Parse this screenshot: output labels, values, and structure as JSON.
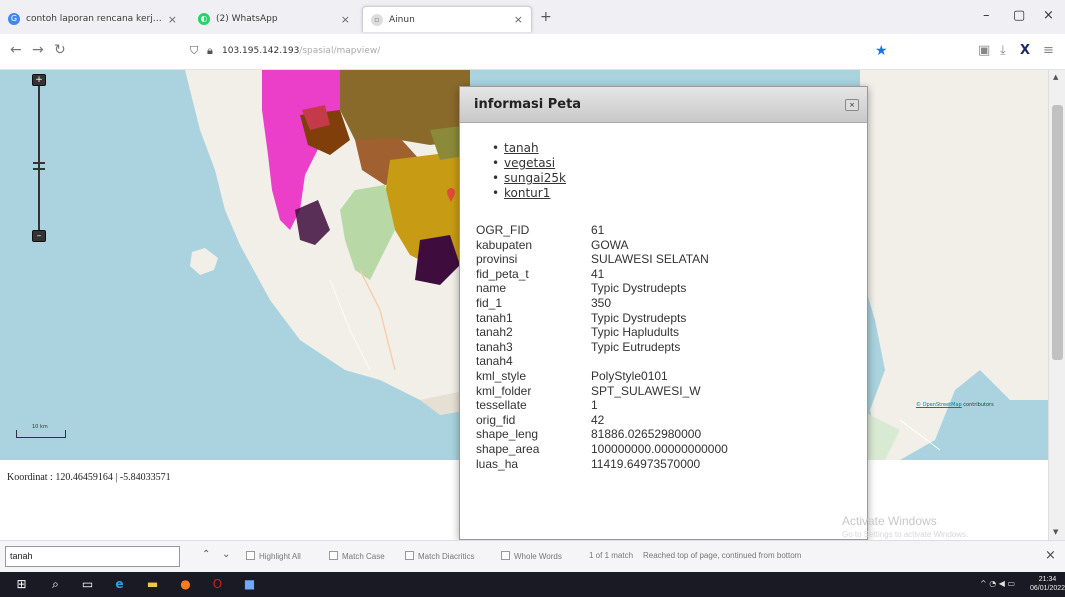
{
  "browser": {
    "tabs": [
      {
        "label": "contoh laporan rencana kerja - ",
        "icon": "google-icon",
        "active": false
      },
      {
        "label": "(2) WhatsApp",
        "icon": "whatsapp-icon",
        "active": false
      },
      {
        "label": "Ainun",
        "icon": "page-icon",
        "active": true
      }
    ],
    "new_tab": "+",
    "url_host": "103.195.142.193",
    "url_path": "/spasial/mapview/"
  },
  "map": {
    "scale_label": "10 km",
    "attribution_link": "© OpenStreetMap",
    "attribution_text": " contributors",
    "coordinates": "Koordinat : 120.46459164 | -5.84033571"
  },
  "popup": {
    "title": "informasi Peta",
    "close": "×",
    "layers": [
      "tanah",
      "vegetasi",
      "sungai25k",
      "kontur1"
    ],
    "attributes": [
      {
        "key": "OGR_FID",
        "value": "61"
      },
      {
        "key": "kabupaten",
        "value": "GOWA"
      },
      {
        "key": "provinsi",
        "value": "SULAWESI SELATAN"
      },
      {
        "key": "fid_peta_t",
        "value": "41"
      },
      {
        "key": "name",
        "value": "Typic Dystrudepts"
      },
      {
        "key": "fid_1",
        "value": "350"
      },
      {
        "key": "tanah1",
        "value": "Typic Dystrudepts"
      },
      {
        "key": "tanah2",
        "value": "Typic Hapludults"
      },
      {
        "key": "tanah3",
        "value": "Typic Eutrudepts"
      },
      {
        "key": "tanah4",
        "value": ""
      },
      {
        "key": "kml_style",
        "value": "PolyStyle0101"
      },
      {
        "key": "kml_folder",
        "value": "SPT_SULAWESI_W"
      },
      {
        "key": "tessellate",
        "value": "1"
      },
      {
        "key": "orig_fid",
        "value": "42"
      },
      {
        "key": "shape_leng",
        "value": "81886.02652980000"
      },
      {
        "key": "shape_area",
        "value": "100000000.00000000000"
      },
      {
        "key": "luas_ha",
        "value": "11419.64973570000"
      }
    ]
  },
  "windows": {
    "watermark_title": "Activate Windows",
    "watermark_sub": "Go to Settings to activate Windows."
  },
  "findbar": {
    "query": "tanah",
    "highlight_all": "Highlight All",
    "match_case": "Match Case",
    "match_diacritics": "Match Diacritics",
    "whole_words": "Whole Words",
    "status": "1 of 1 match",
    "status_note": "Reached top of page, continued from bottom"
  },
  "taskbar": {
    "time": "21:34",
    "date": "06/01/2022"
  }
}
